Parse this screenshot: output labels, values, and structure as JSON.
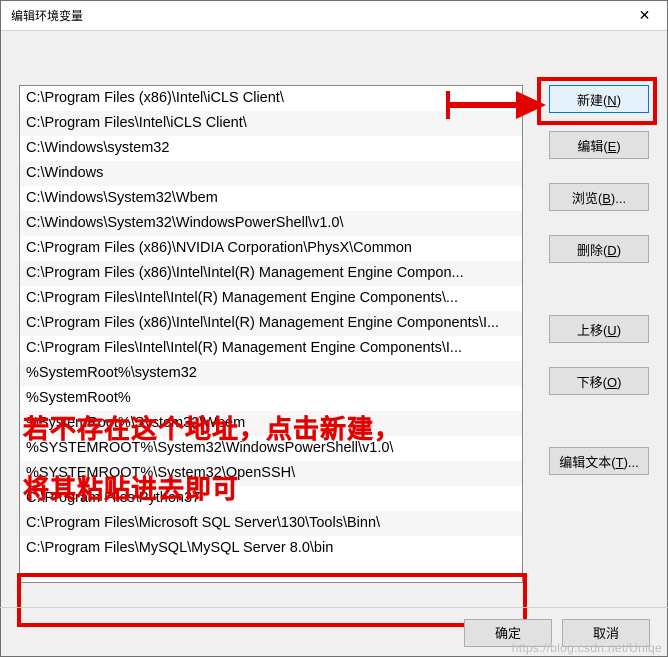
{
  "titlebar": {
    "title": "编辑环境变量",
    "close": "✕"
  },
  "list": {
    "items": [
      "C:\\Program Files (x86)\\Intel\\iCLS Client\\",
      "C:\\Program Files\\Intel\\iCLS Client\\",
      "C:\\Windows\\system32",
      "C:\\Windows",
      "C:\\Windows\\System32\\Wbem",
      "C:\\Windows\\System32\\WindowsPowerShell\\v1.0\\",
      "C:\\Program Files (x86)\\NVIDIA Corporation\\PhysX\\Common",
      "C:\\Program Files (x86)\\Intel\\Intel(R) Management Engine Compon...",
      "C:\\Program Files\\Intel\\Intel(R) Management Engine Components\\...",
      "C:\\Program Files (x86)\\Intel\\Intel(R) Management Engine Components\\I...",
      "C:\\Program Files\\Intel\\Intel(R) Management Engine Components\\I...",
      "%SystemRoot%\\system32",
      "%SystemRoot%",
      "%SystemRoot%\\System32\\Wbem",
      "%SYSTEMROOT%\\System32\\WindowsPowerShell\\v1.0\\",
      "%SYSTEMROOT%\\System32\\OpenSSH\\",
      "C:\\Program Files\\Python37",
      "C:\\Program Files\\Microsoft SQL Server\\130\\Tools\\Binn\\",
      "C:\\Program Files\\MySQL\\MySQL Server 8.0\\bin"
    ]
  },
  "buttons": {
    "new_pre": "新建(",
    "new_k": "N",
    "new_post": ")",
    "edit_pre": "编辑(",
    "edit_k": "E",
    "edit_post": ")",
    "browse_pre": "浏览(",
    "browse_k": "B",
    "browse_post": ")...",
    "delete_pre": "删除(",
    "delete_k": "D",
    "delete_post": ")",
    "up_pre": "上移(",
    "up_k": "U",
    "up_post": ")",
    "down_pre": "下移(",
    "down_k": "O",
    "down_post": ")",
    "edittext_pre": "编辑文本(",
    "edittext_k": "T",
    "edittext_post": ")...",
    "ok": "确定",
    "cancel": "取消"
  },
  "annotation": {
    "line1": "若不存在这个地址，点击新建，",
    "line2": "将其粘贴进去即可"
  },
  "watermark": "https://blog.csdn.net/Uniqe"
}
